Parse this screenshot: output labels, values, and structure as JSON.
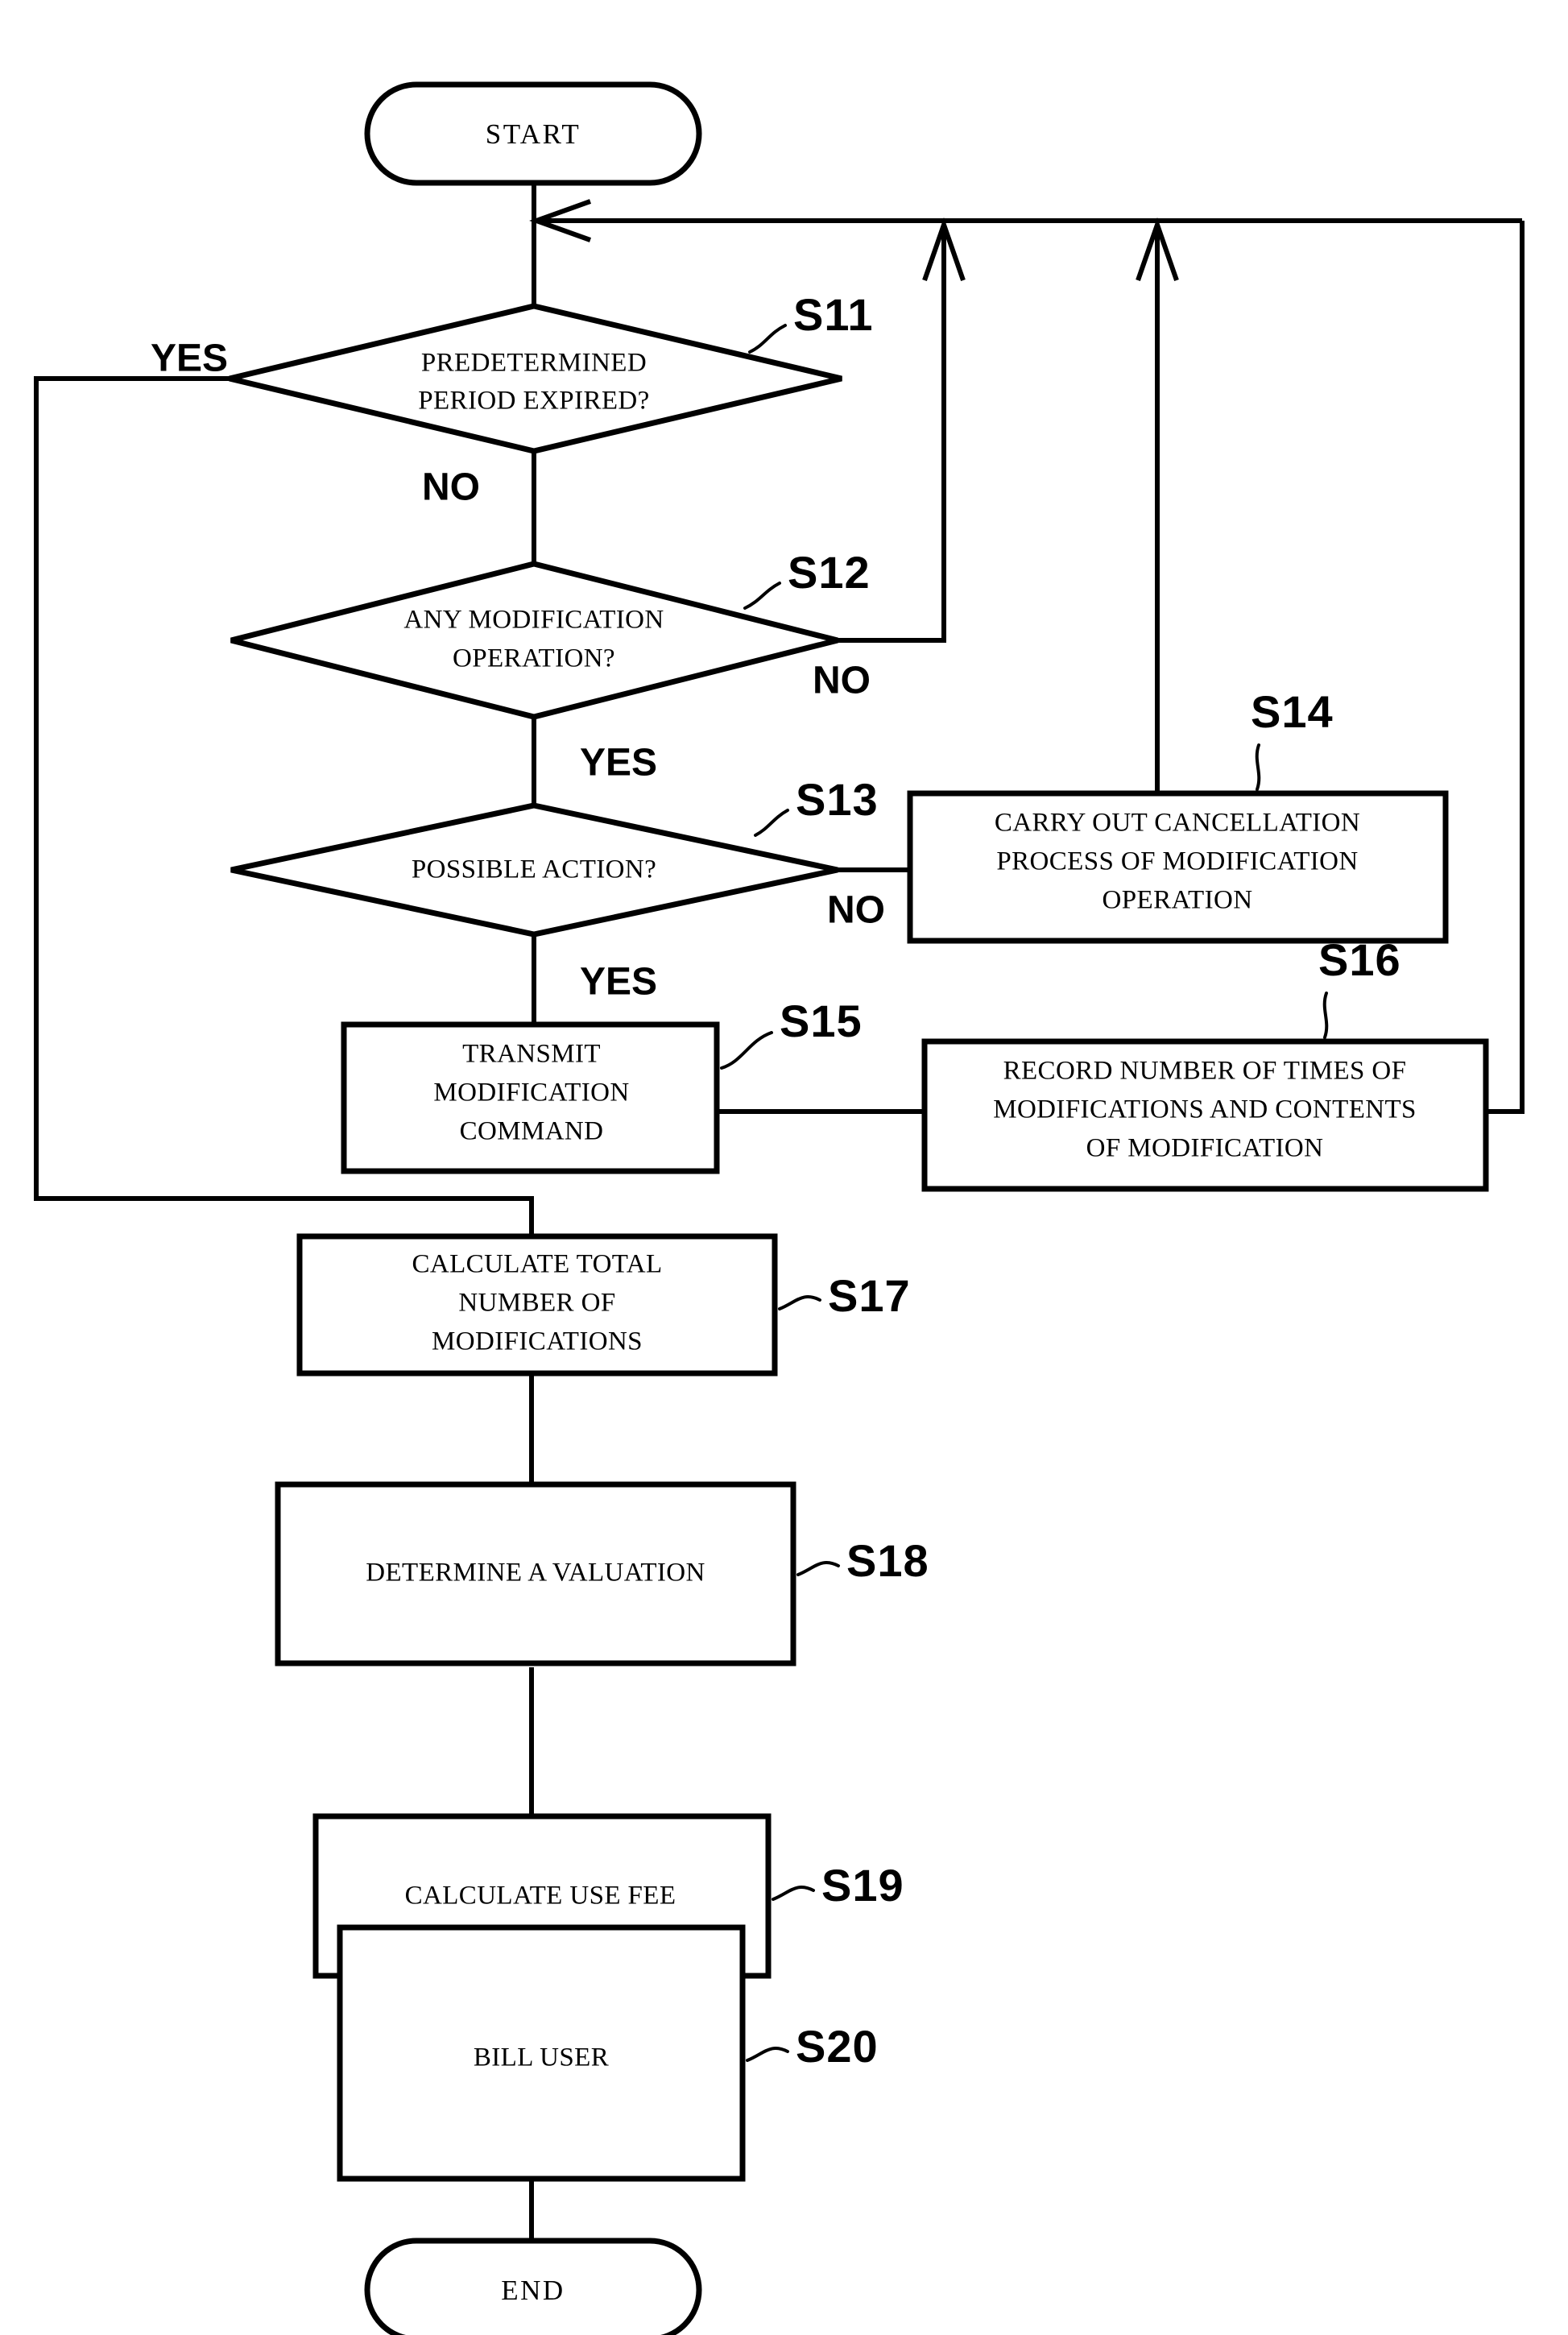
{
  "diagram": {
    "type": "flowchart",
    "title": "",
    "terminals": {
      "start": "START",
      "end": "END"
    },
    "decisions": [
      {
        "id": "S11",
        "step_label": "S11",
        "line1": "PREDETERMINED",
        "line2": "PERIOD EXPIRED?",
        "yes_label": "YES",
        "no_label": "NO"
      },
      {
        "id": "S12",
        "step_label": "S12",
        "line1": "ANY MODIFICATION",
        "line2": "OPERATION?",
        "yes_label": "YES",
        "no_label": "NO"
      },
      {
        "id": "S13",
        "step_label": "S13",
        "line1": "POSSIBLE ACTION?",
        "line2": "",
        "yes_label": "YES",
        "no_label": "NO"
      }
    ],
    "processes": [
      {
        "id": "S14",
        "step_label": "S14",
        "line1": "CARRY OUT CANCELLATION",
        "line2": "PROCESS OF MODIFICATION",
        "line3": "OPERATION"
      },
      {
        "id": "S15",
        "step_label": "S15",
        "line1": "TRANSMIT",
        "line2": "MODIFICATION",
        "line3": "COMMAND"
      },
      {
        "id": "S16",
        "step_label": "S16",
        "line1": "RECORD NUMBER OF TIMES OF",
        "line2": "MODIFICATIONS AND CONTENTS",
        "line3": "OF MODIFICATION"
      },
      {
        "id": "S17",
        "step_label": "S17",
        "line1": "CALCULATE TOTAL",
        "line2": "NUMBER OF",
        "line3": "MODIFICATIONS"
      },
      {
        "id": "S18",
        "step_label": "S18",
        "line1": "DETERMINE A VALUATION",
        "line2": "",
        "line3": ""
      },
      {
        "id": "S19",
        "step_label": "S19",
        "line1": "CALCULATE USE FEE",
        "line2": "",
        "line3": ""
      },
      {
        "id": "S20",
        "step_label": "S20",
        "line1": "BILL USER",
        "line2": "",
        "line3": ""
      }
    ],
    "colors": {
      "stroke": "#000000",
      "fill": "#ffffff",
      "background": "#ffffff"
    }
  }
}
